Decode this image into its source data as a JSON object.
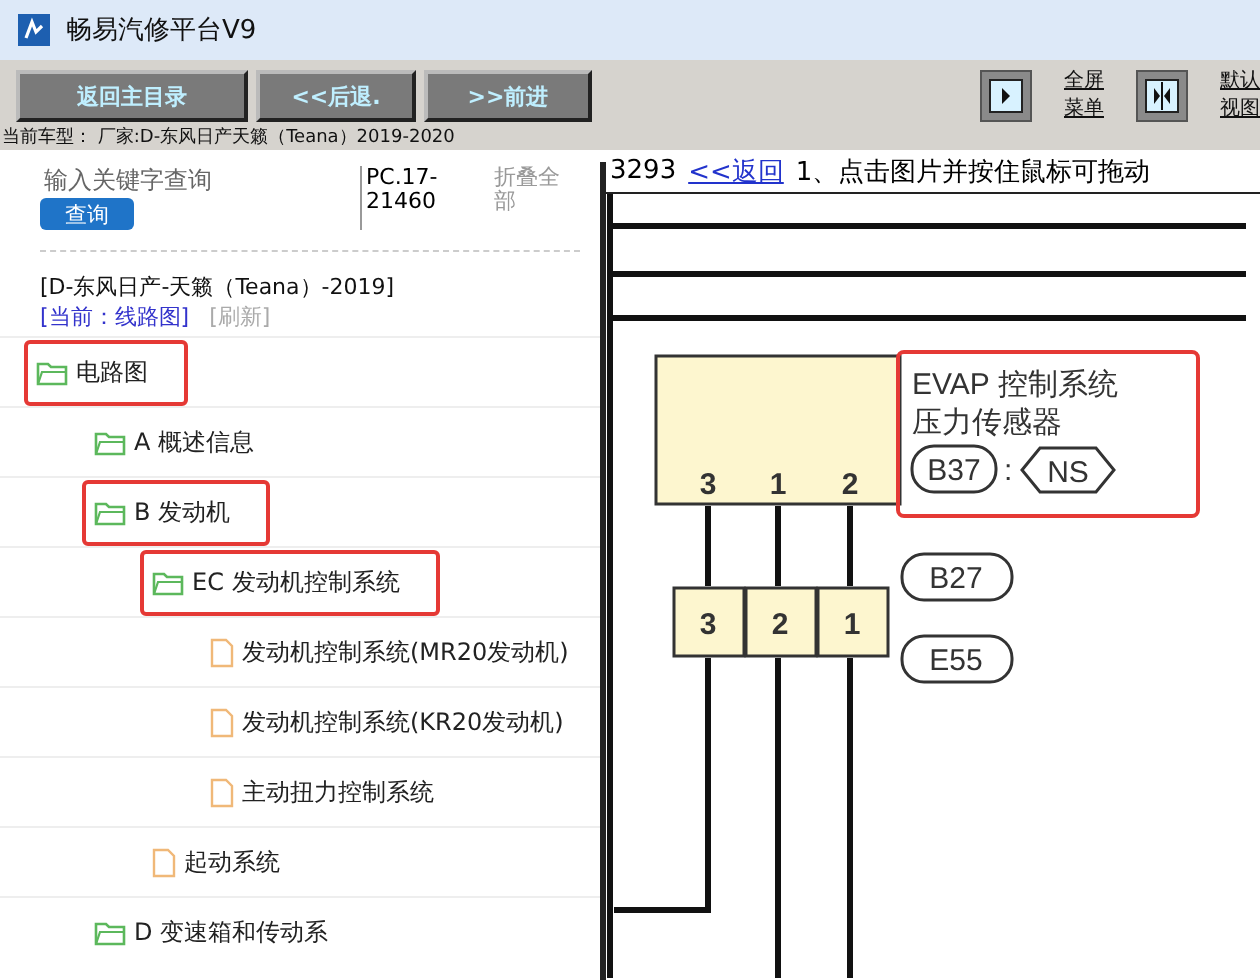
{
  "window": {
    "title": "畅易汽修平台V9"
  },
  "toolbar": {
    "buttons": [
      "返回主目录",
      "<<后退.",
      ">>前进"
    ],
    "view_buttons": [
      {
        "kind": "fullscreen",
        "label_lines": [
          "全屏",
          "菜单"
        ]
      },
      {
        "kind": "default",
        "label_lines": [
          "默认",
          "视图"
        ]
      }
    ],
    "current_model": "当前车型： 厂家:D-东风日产天籁（Teana）2019-2020"
  },
  "sidebar": {
    "search": {
      "placeholder": "输入关键字查询",
      "button": "查询"
    },
    "code": "PC.17-21460",
    "collapse_all": "折叠全部",
    "breadcrumb": "[D-东风日产-天籁（Teana）-2019]",
    "current": "[当前：线路图]",
    "refresh": "[刷新]",
    "tree": [
      {
        "label": "电路图",
        "kind": "folder",
        "highlighted": true,
        "children": [
          {
            "label": "A 概述信息",
            "kind": "folder",
            "highlighted": false
          },
          {
            "label": "B 发动机",
            "kind": "folder",
            "highlighted": true,
            "children": [
              {
                "label": "EC 发动机控制系统",
                "kind": "folder",
                "highlighted": true,
                "children": [
                  {
                    "label": "发动机控制系统(MR20发动机)",
                    "kind": "file",
                    "highlighted": false
                  },
                  {
                    "label": "发动机控制系统(KR20发动机)",
                    "kind": "file",
                    "highlighted": false
                  },
                  {
                    "label": "主动扭力控制系统",
                    "kind": "file",
                    "highlighted": false
                  }
                ]
              },
              {
                "label": "起动系统",
                "kind": "file",
                "highlighted": false
              }
            ]
          },
          {
            "label": "D 变速箱和传动系",
            "kind": "folder",
            "highlighted": false
          }
        ]
      }
    ]
  },
  "viewer": {
    "page": "3293",
    "back_link": "<<返回",
    "hint": "1、点击图片并按住鼠标可拖动",
    "diagram": {
      "component_lines": [
        "EVAP 控制系统",
        "压力传感器"
      ],
      "component_connector": "B37",
      "separator": ":",
      "harness": "NS",
      "highlighted": true,
      "component_pins": [
        "3",
        "1",
        "2"
      ],
      "joint_pins": [
        "3",
        "2",
        "1"
      ],
      "joint_connectors": [
        "B27",
        "E55"
      ]
    }
  }
}
